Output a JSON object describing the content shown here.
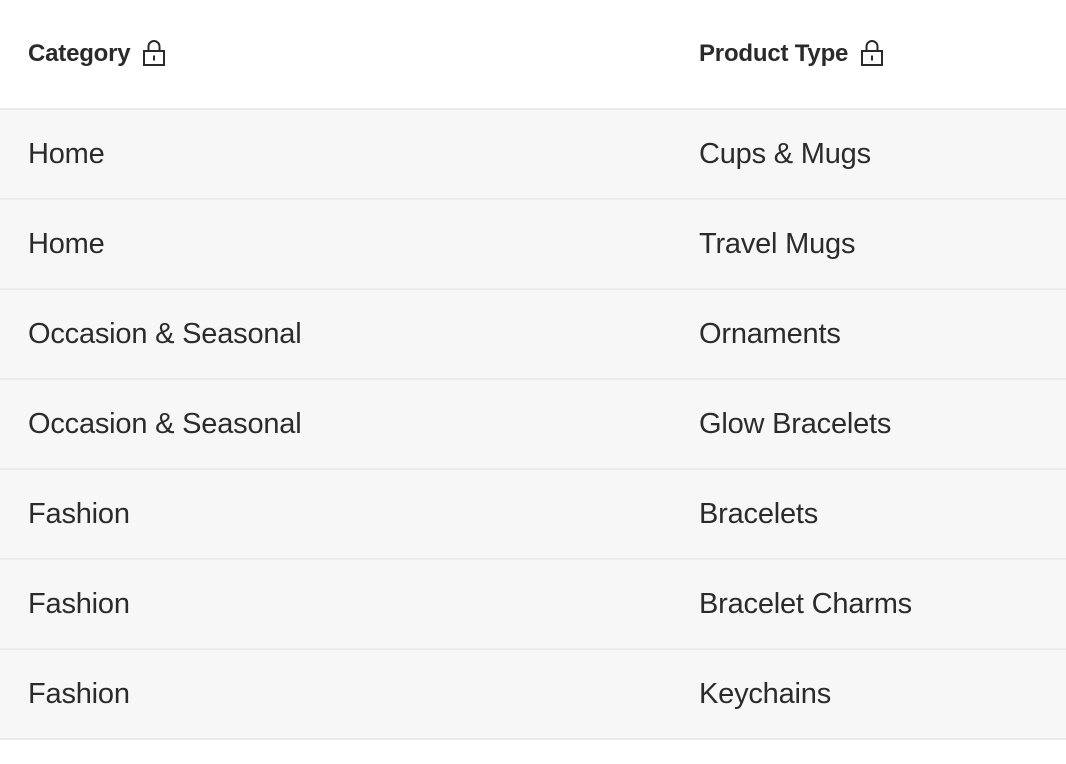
{
  "table": {
    "columns": [
      {
        "label": "Category",
        "locked": true,
        "icon": "lock-icon"
      },
      {
        "label": "Product Type",
        "locked": true,
        "icon": "lock-icon"
      }
    ],
    "rows": [
      {
        "category": "Home",
        "product_type": "Cups & Mugs"
      },
      {
        "category": "Home",
        "product_type": "Travel Mugs"
      },
      {
        "category": "Occasion & Seasonal",
        "product_type": "Ornaments"
      },
      {
        "category": "Occasion & Seasonal",
        "product_type": "Glow Bracelets"
      },
      {
        "category": "Fashion",
        "product_type": "Bracelets"
      },
      {
        "category": "Fashion",
        "product_type": "Bracelet Charms"
      },
      {
        "category": "Fashion",
        "product_type": "Keychains"
      }
    ]
  },
  "colors": {
    "header_background": "#ffffff",
    "row_background": "#f7f7f7",
    "row_divider": "#ececec",
    "text": "#2b2b2b"
  }
}
